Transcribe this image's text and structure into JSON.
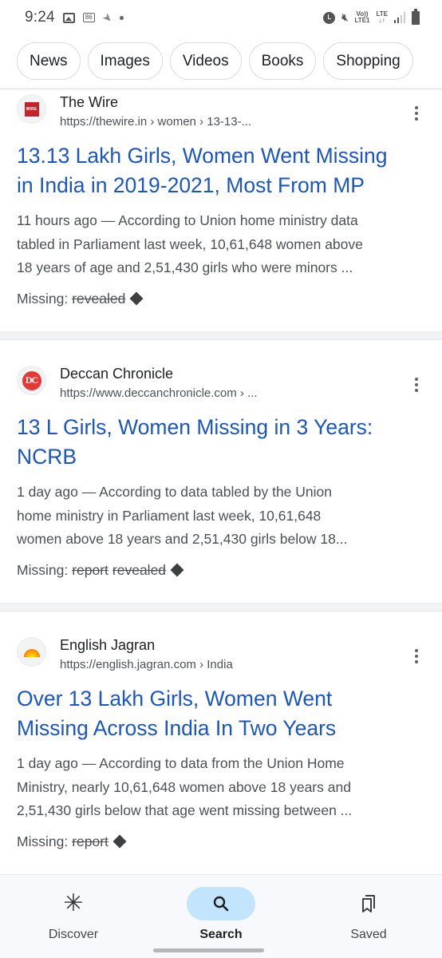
{
  "status_bar": {
    "time": "9:24",
    "notification_badge": "86",
    "left_icons": [
      "gallery-icon",
      "badge-icon",
      "rocket-icon",
      "dot-icon"
    ],
    "right_icons": [
      "alarm-icon",
      "vibrate-mute-icon",
      "volte-icon",
      "lte-icon",
      "signal-icon",
      "battery-icon"
    ],
    "volte_label_top": "Vo))",
    "volte_label_bottom": "LTE1",
    "lte_label": "LTE",
    "lte_arrows": "↓↑"
  },
  "chips": [
    {
      "label": "News"
    },
    {
      "label": "Images"
    },
    {
      "label": "Videos"
    },
    {
      "label": "Books"
    },
    {
      "label": "Shopping"
    }
  ],
  "results": [
    {
      "source_name": "The Wire",
      "favicon": "wire-logo",
      "favicon_text": "WIRE",
      "url": "https://thewire.in › women › 13-13-...",
      "title_line1": "13.13 Lakh Girls, Women Went Missing",
      "title_line2": "in India in 2019-2021, Most From MP",
      "snippet_line1": "11 hours ago — According to Union home ministry data",
      "snippet_line2": "tabled in Parliament last week, 10,61,648 women above",
      "snippet_line3": "18 years of age and 2,51,430 girls who were minors ...",
      "missing_label": "Missing:",
      "missing_terms": [
        "revealed"
      ]
    },
    {
      "source_name": "Deccan Chronicle",
      "favicon": "deccan-chronicle-logo",
      "favicon_text": "DC",
      "url": "https://www.deccanchronicle.com › ...",
      "title_line1": "13 L Girls, Women Missing in 3 Years:",
      "title_line2": "NCRB",
      "snippet_line1": "1 day ago — According to data tabled by the Union",
      "snippet_line2": "home ministry in Parliament last week, 10,61,648",
      "snippet_line3": "women above 18 years and 2,51,430 girls below 18...",
      "missing_label": "Missing:",
      "missing_terms": [
        "report",
        "revealed"
      ]
    },
    {
      "source_name": "English Jagran",
      "favicon": "jagran-logo",
      "favicon_text": "",
      "url": "https://english.jagran.com › India",
      "title_line1": "Over 13 Lakh Girls, Women Went",
      "title_line2": "Missing Across India In Two Years",
      "snippet_line1": "1 day ago — According to data from the Union Home",
      "snippet_line2": "Ministry, nearly 10,61,648 women above 18 years and",
      "snippet_line3": "2,51,430 girls below that age went missing between ...",
      "missing_label": "Missing:",
      "missing_terms": [
        "report"
      ]
    }
  ],
  "bottom_nav": {
    "items": [
      {
        "label": "Discover",
        "icon": "asterisk-icon",
        "active": false
      },
      {
        "label": "Search",
        "icon": "search-icon",
        "active": true
      },
      {
        "label": "Saved",
        "icon": "bookmarks-icon",
        "active": false
      }
    ]
  },
  "colors": {
    "link_blue": "#1a56c4",
    "active_nav_pill": "#c2e4fc",
    "snippet_gray": "#4d5156"
  }
}
